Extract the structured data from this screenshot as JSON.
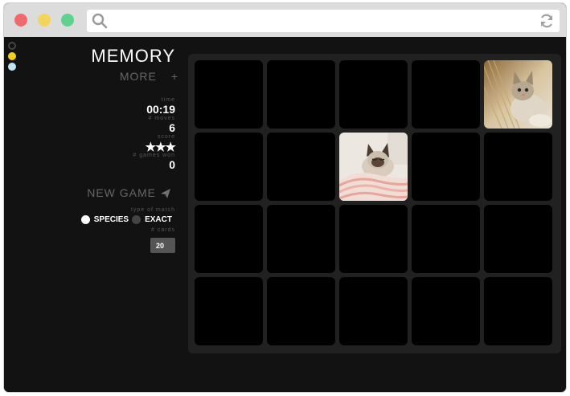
{
  "window": {
    "traffic_lights": [
      "#ef6a6c",
      "#f4d55b",
      "#5fd28f"
    ]
  },
  "toolbar": {
    "search_icon": "search-icon",
    "reload_icon": "reload-icon"
  },
  "sidebar": {
    "theme_swatches": [
      "#111111",
      "#f2cf1d",
      "#bfe3f6"
    ],
    "title": "MEMORY",
    "more_label": "MORE",
    "more_plus": "+",
    "time_label": "time",
    "time_value": "00:19",
    "moves_label": "# moves",
    "moves_value": "6",
    "score_label": "score",
    "score_value": "★★★",
    "games_won_label": "# games won",
    "games_won_value": "0",
    "new_game_label": "NEW GAME",
    "match_type_label": "type of match",
    "match_options": [
      "SPECIES",
      "EXACT"
    ],
    "match_selected": "SPECIES",
    "cards_label": "# cards",
    "cards_value": "20"
  },
  "board": {
    "rows": 4,
    "columns": 5,
    "revealed_cards": [
      {
        "row": 1,
        "col": 5,
        "image": "kitten-on-sunlit-cushion"
      },
      {
        "row": 2,
        "col": 3,
        "image": "siamese-kitten-on-pink-blanket"
      }
    ]
  }
}
